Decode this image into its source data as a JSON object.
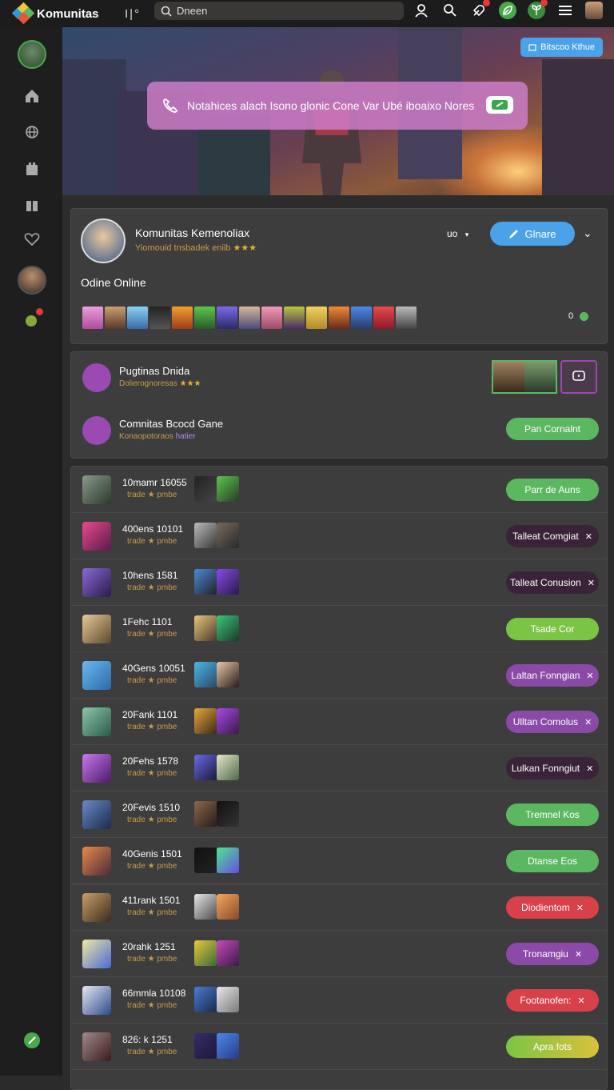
{
  "header": {
    "brand": "Komunitas",
    "extra": "I|°",
    "search_value": "Dneen"
  },
  "hero": {
    "button_label": "Bitscoo Kthue",
    "notice_text": "Notahices alach Isono glonic Cone Var Ubé iboaixo Nores"
  },
  "profile": {
    "name": "Komunitas Kemenoliax",
    "subtitle": "Yiomouid tnsbadek enilb",
    "stars": "★★★",
    "uo_label": "uo",
    "primary_button": "Glnare",
    "online_label": "Odine Online",
    "count": "0"
  },
  "groups": [
    {
      "title": "Pugtinas Dnida",
      "sub": "Dolierognoresas",
      "stars": "★★★"
    },
    {
      "title": "Comnitas Bcocd Gane",
      "sub": "Konaopotoraos",
      "tag": "hatier",
      "button": "Pan Cornalnt"
    }
  ],
  "rows": [
    {
      "title": "10mamr 16055",
      "sub": "trade",
      "sub2": "pmbe",
      "button": "Parr de Auns",
      "style": "green",
      "x": false
    },
    {
      "title": "400ens 10101",
      "sub": "trade",
      "sub2": "pmbe",
      "button": "Talleat Comgiat",
      "style": "dark",
      "x": true
    },
    {
      "title": "10hens 1581",
      "sub": "trade",
      "sub2": "pmbe",
      "button": "Talleat Conusion",
      "style": "dark",
      "x": true
    },
    {
      "title": "1Fehc 1101",
      "sub": "trade",
      "sub2": "pmbe",
      "button": "Tsade Cor",
      "style": "lime",
      "x": false
    },
    {
      "title": "40Gens 10051",
      "sub": "trade",
      "sub2": "pmbe",
      "button": "Laltan Fonngian",
      "style": "purple",
      "x": true
    },
    {
      "title": "20Fank 1101",
      "sub": "trade",
      "sub2": "pmbe",
      "button": "Ulltan Comolus",
      "style": "purple",
      "x": true
    },
    {
      "title": "20Fehs 1578",
      "sub": "trade",
      "sub2": "pmbe",
      "button": "Lulkan Fonngiut",
      "style": "dark",
      "x": true
    },
    {
      "title": "20Fevis 1510",
      "sub": "trade",
      "sub2": "pmbe",
      "button": "Tremnel Kos",
      "style": "green",
      "x": false
    },
    {
      "title": "40Genis 1501",
      "sub": "trade",
      "sub2": "pmbe",
      "button": "Dtanse Eos",
      "style": "green",
      "x": false
    },
    {
      "title": "411rank 1501",
      "sub": "trade",
      "sub2": "pmbe",
      "button": "Diodientom",
      "style": "red",
      "x": true
    },
    {
      "title": "20rahk 1251",
      "sub": "trade",
      "sub2": "pmbe",
      "button": "Tronamgiu",
      "style": "purple",
      "x": true
    },
    {
      "title": "66mmla 10108",
      "sub": "trade",
      "sub2": "pmbe",
      "button": "Footanofen:",
      "style": "red",
      "x": true
    },
    {
      "title": "826: k 1251",
      "sub": "trade",
      "sub2": "pmbe",
      "button": "Apra fots",
      "style": "ylgreen",
      "x": false
    }
  ],
  "colors": {
    "accent_blue": "#4aa3e8",
    "accent_green": "#5cb860",
    "accent_purple": "#8b4aa8",
    "accent_red": "#d8404a",
    "notice_pink": "#cd7dc8"
  }
}
